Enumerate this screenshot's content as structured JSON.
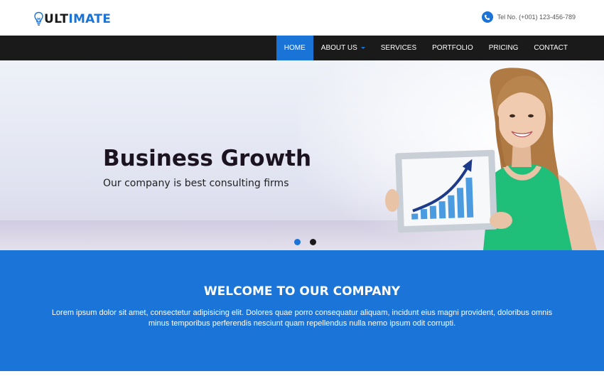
{
  "header": {
    "logo": {
      "part1": "ULT",
      "part2": "IMATE",
      "icon": "lightbulb-icon"
    },
    "phone": {
      "icon": "phone-icon",
      "text": "Tel No. (+001) 123-456-789"
    }
  },
  "nav": {
    "items": [
      {
        "label": "HOME",
        "active": true
      },
      {
        "label": "ABOUT US",
        "dropdown": true
      },
      {
        "label": "SERVICES"
      },
      {
        "label": "PORTFOLIO"
      },
      {
        "label": "PRICING"
      },
      {
        "label": "CONTACT"
      }
    ]
  },
  "hero": {
    "title": "Business Growth",
    "subtitle": "Our company is best consulting firms",
    "slides": 2,
    "active_slide": 1
  },
  "welcome": {
    "title": "WELCOME TO OUR COMPANY",
    "text": "Lorem ipsum dolor sit amet, consectetur adipisicing elit. Dolores quae porro consequatur aliquam, incidunt eius magni provident, doloribus omnis minus temporibus perferendis nesciunt quam repellendus nulla nemo ipsum odit corrupti."
  },
  "colors": {
    "accent": "#1a73d6",
    "navbar": "#1a1a1a",
    "dot_inactive": "#1a1a1a"
  }
}
